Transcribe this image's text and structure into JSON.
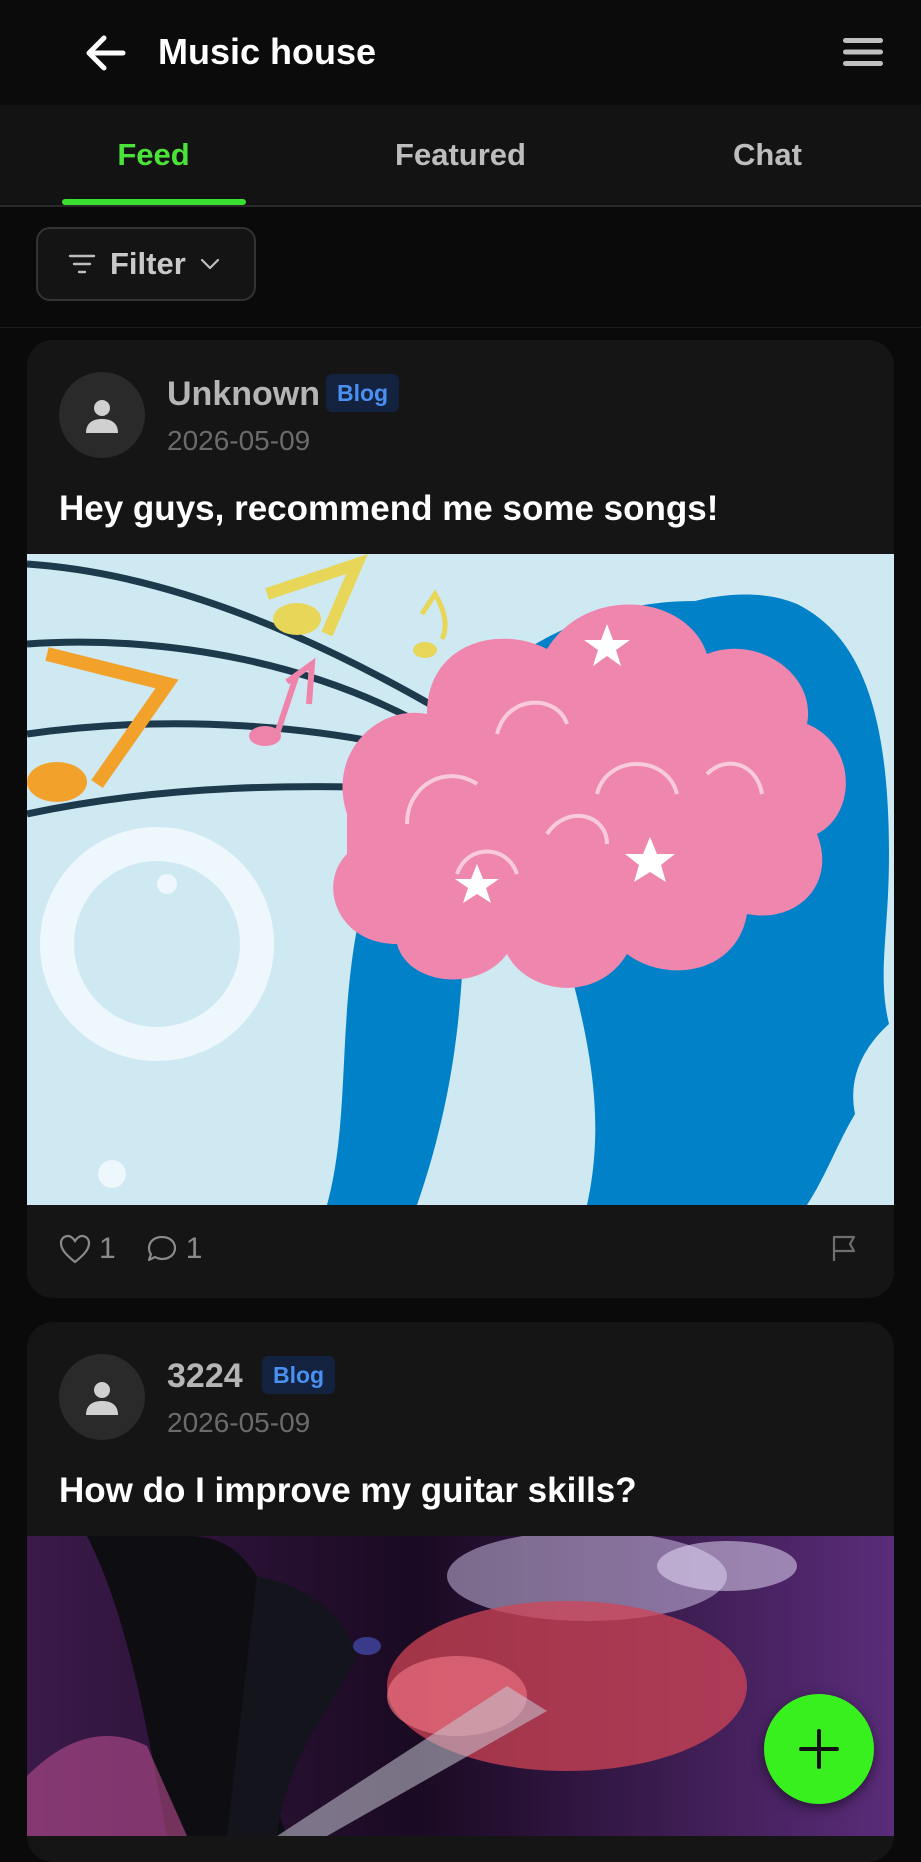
{
  "header": {
    "title": "Music house",
    "back_icon": "arrow-left-icon",
    "menu_icon": "hamburger-menu-icon"
  },
  "tabs": [
    {
      "label": "Feed",
      "active": true
    },
    {
      "label": "Featured",
      "active": false
    },
    {
      "label": "Chat",
      "active": false
    }
  ],
  "filter": {
    "label": "Filter",
    "icon": "filter-icon",
    "chevron": "chevron-down-icon"
  },
  "posts": [
    {
      "author": "Unknown",
      "badge": "Blog",
      "date": "2026-05-09",
      "title": "Hey guys, recommend me some songs!",
      "image": "brain-music-illustration",
      "likes": "1",
      "comments": "1"
    },
    {
      "author": "3224",
      "badge": "Blog",
      "date": "2026-05-09",
      "title": "How do I improve my guitar skills?",
      "image": "guitar-player-photo"
    }
  ],
  "fab": {
    "icon": "plus-icon"
  },
  "colors": {
    "accent": "#39e02f",
    "fab": "#39f01f",
    "badge_text": "#4a8ff2",
    "card_bg": "#151515",
    "page_bg": "#0a0a0a"
  }
}
